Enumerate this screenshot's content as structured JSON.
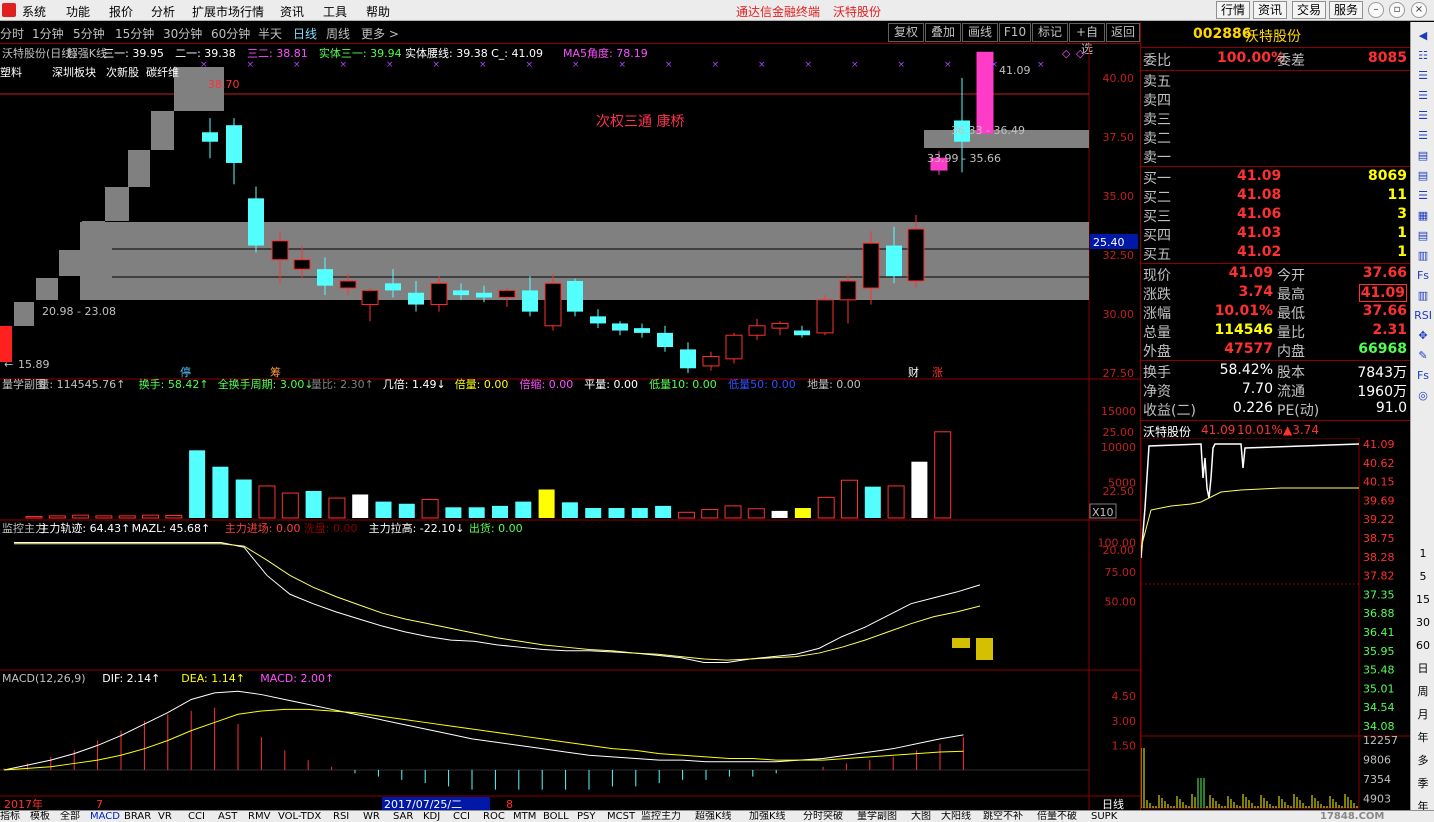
{
  "menu": {
    "items": [
      "系统",
      "功能",
      "报价",
      "分析",
      "扩展市场行情",
      "资讯",
      "工具",
      "帮助"
    ],
    "brand1": "通达信金融终端",
    "brand2": "沃特股份",
    "right_buttons": [
      "行情",
      "资讯",
      "交易",
      "服务"
    ]
  },
  "periods": {
    "items": [
      "分时",
      "1分钟",
      "5分钟",
      "15分钟",
      "30分钟",
      "60分钟",
      "半天",
      "日线",
      "周线",
      "更多 >"
    ],
    "active": "日线"
  },
  "toolbar": {
    "items": [
      "复权",
      "叠加",
      "画线",
      "F10",
      "标记",
      "+自选",
      "返回"
    ]
  },
  "kline": {
    "info": [
      {
        "t": "沃特股份(日线)",
        "c": "#c0c0c0"
      },
      {
        "t": "超强K线",
        "c": "#c0c0c0"
      },
      {
        "t": "三一: 39.95",
        "c": "#ffffff"
      },
      {
        "t": "二一: 39.38",
        "c": "#ffffff"
      },
      {
        "t": "三二: 38.81",
        "c": "#ff50ff"
      },
      {
        "t": "实体三一: 39.94",
        "c": "#50ff50"
      },
      {
        "t": "实体腰线: 39.38",
        "c": "#ffffff"
      },
      {
        "t": "C_: 41.09",
        "c": "#ffffff"
      },
      {
        "t": "MA5角度: 78.19",
        "c": "#ff50ff"
      }
    ],
    "tags": [
      "塑料",
      "深圳板块",
      "次新股",
      "碳纤维"
    ],
    "annotation": "次权三通 康桥",
    "label_low": "15.89",
    "label_high": "41.09",
    "label_topred": "38.70",
    "label_range1": "20.98 - 23.08",
    "label_range2": "33.99 - 35.66",
    "label_range3": "36.33 - 36.49",
    "marker_ting": "停",
    "marker_chou": "筹",
    "marker_cai": "财",
    "marker_zhang": "涨",
    "y_ticks": [
      "40.00",
      "37.50",
      "35.00",
      "32.50",
      "30.00",
      "27.50",
      "25.00",
      "22.50",
      "20.00"
    ],
    "price_tag": "25.40"
  },
  "volume": {
    "info": [
      {
        "t": "量学副图",
        "c": "#c0c0c0"
      },
      {
        "t": "量: 114545.76↑",
        "c": "#c0c0c0"
      },
      {
        "t": "换手: 58.42↑",
        "c": "#50ff50"
      },
      {
        "t": "全换手周期: 3.00↓",
        "c": "#50ff50"
      },
      {
        "t": "量比: 2.30↑",
        "c": "#808080"
      },
      {
        "t": "几倍: 1.49↓",
        "c": "#ffffff"
      },
      {
        "t": "倍量: 0.00",
        "c": "#ffff00"
      },
      {
        "t": "倍缩: 0.00",
        "c": "#ff50ff"
      },
      {
        "t": "平量: 0.00",
        "c": "#ffffff"
      },
      {
        "t": "低量10: 0.00",
        "c": "#50ff50"
      },
      {
        "t": "低量50: 0.00",
        "c": "#3050ff"
      },
      {
        "t": "地量: 0.00",
        "c": "#c0c0c0"
      }
    ],
    "y_ticks": [
      "15000",
      "10000",
      "5000"
    ],
    "unit": "X10",
    "values": [
      200,
      300,
      400,
      300,
      300,
      400,
      350,
      9500,
      7200,
      5400,
      4500,
      3500,
      3800,
      2800,
      3300,
      2300,
      2000,
      2600,
      1500,
      1500,
      1700,
      2300,
      4000,
      2200,
      1400,
      1400,
      1400,
      1700,
      800,
      1200,
      1700,
      1300,
      1000,
      1400,
      2900,
      5300,
      4400,
      4500,
      7900,
      12100
    ],
    "colors": [
      "r",
      "r",
      "r",
      "r",
      "r",
      "r",
      "r",
      "c",
      "c",
      "c",
      "r",
      "r",
      "c",
      "r",
      "w",
      "c",
      "c",
      "r",
      "c",
      "c",
      "c",
      "c",
      "y",
      "c",
      "c",
      "c",
      "c",
      "c",
      "r",
      "r",
      "r",
      "r",
      "w",
      "y",
      "r",
      "r",
      "c",
      "r",
      "w",
      "r"
    ]
  },
  "mainforce": {
    "info": [
      {
        "t": "监控主力",
        "c": "#c0c0c0"
      },
      {
        "t": "主力轨迹: 64.43↑",
        "c": "#ffffff"
      },
      {
        "t": "MAZL: 45.68↑",
        "c": "#ffffff"
      },
      {
        "t": "主力进场: 0.00",
        "c": "#ff4040"
      },
      {
        "t": "洗盘: 0.00",
        "c": "#8b0000"
      },
      {
        "t": "主力拉高: -22.10↓",
        "c": "#ffffff"
      },
      {
        "t": "出货: 0.00",
        "c": "#50ff50"
      }
    ],
    "y_ticks": [
      "100.00",
      "75.00",
      "50.00"
    ],
    "line1": [
      100,
      100,
      100,
      100,
      100,
      100,
      100,
      100,
      100,
      100,
      96,
      72,
      56,
      48,
      41,
      35,
      29,
      24,
      20,
      17,
      16,
      13,
      11,
      9,
      8,
      8,
      7,
      6,
      4,
      2,
      -2,
      -2,
      1,
      3,
      5,
      10,
      20,
      28,
      38,
      48,
      53,
      58,
      64
    ],
    "line2": [
      99,
      99,
      99,
      99,
      99,
      99,
      99,
      99,
      99,
      99,
      97,
      85,
      72,
      62,
      54,
      47,
      40,
      35,
      31,
      27,
      23,
      19,
      16,
      13,
      11,
      9,
      8,
      6,
      5,
      3,
      1,
      0,
      1,
      2,
      3,
      6,
      11,
      17,
      24,
      31,
      37,
      41,
      46
    ]
  },
  "macd": {
    "info": [
      {
        "t": "MACD(12,26,9)",
        "c": "#c0c0c0"
      },
      {
        "t": "DIF: 2.14↑",
        "c": "#ffffff"
      },
      {
        "t": "DEA: 1.14↑",
        "c": "#ffff00"
      },
      {
        "t": "MACD: 2.00↑",
        "c": "#ff50ff"
      }
    ],
    "y_ticks": [
      "4.50",
      "3.00",
      "1.50"
    ],
    "dif": [
      0.0,
      0.3,
      0.6,
      1.0,
      1.5,
      2.1,
      2.8,
      3.5,
      4.3,
      4.7,
      4.8,
      4.6,
      4.3,
      4.0,
      3.7,
      3.4,
      3.1,
      2.8,
      2.5,
      2.2,
      1.9,
      1.7,
      1.5,
      1.3,
      1.1,
      0.9,
      0.8,
      0.7,
      0.6,
      0.6,
      0.5,
      0.5,
      0.5,
      0.5,
      0.6,
      0.7,
      0.9,
      1.1,
      1.3,
      1.6,
      1.9,
      2.14
    ],
    "dea": [
      0.0,
      0.1,
      0.2,
      0.4,
      0.6,
      0.9,
      1.3,
      1.8,
      2.4,
      2.9,
      3.4,
      3.6,
      3.7,
      3.7,
      3.6,
      3.5,
      3.3,
      3.1,
      2.9,
      2.7,
      2.5,
      2.3,
      2.1,
      1.9,
      1.7,
      1.5,
      1.3,
      1.2,
      1.0,
      0.9,
      0.8,
      0.7,
      0.7,
      0.6,
      0.6,
      0.6,
      0.7,
      0.8,
      0.9,
      1.0,
      1.1,
      1.14
    ],
    "bars": [
      0.1,
      0.4,
      0.8,
      1.2,
      1.8,
      2.4,
      3.0,
      3.4,
      3.6,
      3.8,
      2.8,
      2.0,
      1.2,
      0.6,
      0.2,
      -0.2,
      -0.4,
      -0.6,
      -0.8,
      -1.0,
      -1.2,
      -1.2,
      -1.2,
      -1.2,
      -1.2,
      -1.2,
      -1.0,
      -1.0,
      -0.8,
      -0.6,
      -0.6,
      -0.4,
      -0.4,
      -0.2,
      0.0,
      0.2,
      0.4,
      0.6,
      0.8,
      1.2,
      1.6,
      2.0
    ]
  },
  "timeline": {
    "year": "2017年",
    "m7": "7",
    "date": "2017/07/25/二",
    "m8": "8"
  },
  "quote": {
    "code": "002886",
    "name": "沃特股份",
    "weibi_label": "委比",
    "weibi": "100.00%",
    "weicha_label": "委差",
    "weicha": "8085",
    "sells": [
      {
        "l": "卖五",
        "p": "",
        "v": ""
      },
      {
        "l": "卖四",
        "p": "",
        "v": ""
      },
      {
        "l": "卖三",
        "p": "",
        "v": ""
      },
      {
        "l": "卖二",
        "p": "",
        "v": ""
      },
      {
        "l": "卖一",
        "p": "",
        "v": ""
      }
    ],
    "buys": [
      {
        "l": "买一",
        "p": "41.09",
        "v": "8069"
      },
      {
        "l": "买二",
        "p": "41.08",
        "v": "11"
      },
      {
        "l": "买三",
        "p": "41.06",
        "v": "3"
      },
      {
        "l": "买四",
        "p": "41.03",
        "v": "1"
      },
      {
        "l": "买五",
        "p": "41.02",
        "v": "1"
      }
    ],
    "stats": [
      {
        "l1": "现价",
        "v1": "41.09",
        "c1": "#ff3030",
        "l2": "今开",
        "v2": "37.66",
        "c2": "#ff3030"
      },
      {
        "l1": "涨跌",
        "v1": "3.74",
        "c1": "#ff3030",
        "l2": "最高",
        "v2": "41.09",
        "c2": "#ff3030"
      },
      {
        "l1": "涨幅",
        "v1": "10.01%",
        "c1": "#ff3030",
        "l2": "最低",
        "v2": "37.66",
        "c2": "#ff3030"
      },
      {
        "l1": "总量",
        "v1": "114546",
        "c1": "#ffff00",
        "l2": "量比",
        "v2": "2.31",
        "c2": "#ff3030"
      },
      {
        "l1": "外盘",
        "v1": "47577",
        "c1": "#ff3030",
        "l2": "内盘",
        "v2": "66968",
        "c2": "#50ff50"
      }
    ],
    "stats2": [
      {
        "l1": "换手",
        "v1": "58.42%",
        "l2": "股本",
        "v2": "7843万"
      },
      {
        "l1": "净资",
        "v1": "7.70",
        "l2": "流通",
        "v2": "1960万"
      },
      {
        "l1": "收益(二)",
        "v1": "0.226",
        "l2": "PE(动)",
        "v2": "91.0"
      }
    ]
  },
  "minichart": {
    "title": "沃特股份",
    "price": "41.09",
    "pct": "10.01%",
    "chg": "▲3.74",
    "y_ticks": [
      "41.09",
      "40.62",
      "40.15",
      "39.69",
      "39.22",
      "38.75",
      "38.28",
      "37.82",
      "37.35",
      "36.88",
      "36.41",
      "35.95",
      "35.48",
      "35.01",
      "34.54",
      "34.08"
    ],
    "vol_ticks": [
      "12257",
      "9806",
      "7354",
      "4903"
    ]
  },
  "righttools": [
    "1",
    "5",
    "15",
    "30",
    "60",
    "日",
    "周",
    "月",
    "年",
    "多",
    "季",
    "年"
  ],
  "bottom": {
    "tabs": [
      "指标",
      "模板",
      "全部",
      "MACD",
      "BRAR",
      "VR",
      "CCI",
      "AST",
      "RMV",
      "VOL-TDX",
      "RSI",
      "WR",
      "SAR",
      "KDJ",
      "CCI",
      "ROC",
      "MTM",
      "BOLL",
      "PSY",
      "MCST",
      "监控主力",
      "超强K线",
      "加强K线",
      "分时突破",
      "量学副图",
      "大图",
      "大阳线",
      "跳空不补",
      "倍量不破",
      "SUPK"
    ],
    "watermark": "17848.COM"
  }
}
